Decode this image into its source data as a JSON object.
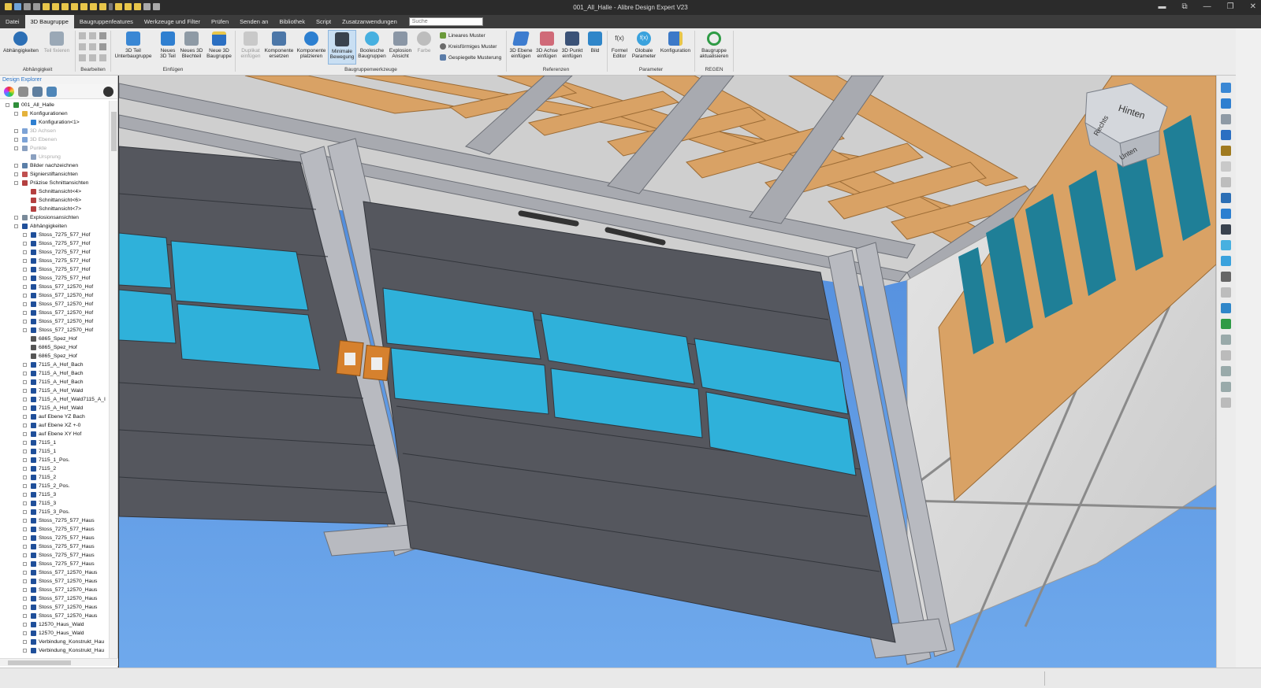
{
  "window": {
    "title": "001_All_Halle - Alibre Design Expert V23",
    "controls": [
      "▬",
      "⧉",
      "—",
      "❐",
      "✕"
    ]
  },
  "menu": {
    "items": [
      "Datei",
      "3D Baugruppe",
      "Baugruppenfeatures",
      "Werkzeuge und Filter",
      "Prüfen",
      "Senden an",
      "Bibliothek",
      "Script",
      "Zusatzanwendungen"
    ],
    "active_index": 1,
    "search_placeholder": "Suche"
  },
  "ribbon": {
    "groups": {
      "abhaengigkeit": "Abhängigkeit",
      "bearbeiten": "Bearbeiten",
      "einfuegen": "Einfügen",
      "baugruppenwerkzeuge": "Baugruppenwerkzeuge",
      "referenzen": "Referenzen",
      "parameter": "Parameter",
      "regen": "REGEN"
    },
    "buttons": {
      "abhaengigkeiten": [
        "Abhängigkeiten",
        ""
      ],
      "teil_fixieren": [
        "Teil fixieren",
        ""
      ],
      "teil_unterbaugruppe": [
        "3D Teil",
        "Unterbaugruppe"
      ],
      "neues_teil": [
        "Neues",
        "3D Teil"
      ],
      "neues_blechteil": [
        "Neues 3D",
        "Blechteil"
      ],
      "neue_baugruppe": [
        "Neue 3D",
        "Baugruppe"
      ],
      "duplikat": [
        "Duplikat",
        "einfügen"
      ],
      "komponente_ersetzen": [
        "Komponente",
        "ersetzen"
      ],
      "komponente_platzieren": [
        "Komponente",
        "platzieren"
      ],
      "minimale_bewegung": [
        "Minimale",
        "Bewegung"
      ],
      "boolesche": [
        "Boolesche",
        "Baugruppen"
      ],
      "explosion": [
        "Explosion",
        "Ansicht"
      ],
      "farbe": [
        "Farbe",
        ""
      ],
      "ebene": [
        "3D Ebene",
        "einfügen"
      ],
      "achse": [
        "3D Achse",
        "einfügen"
      ],
      "punkt": [
        "3D Punkt",
        "einfügen"
      ],
      "bild": [
        "Bild",
        ""
      ],
      "formel": [
        "Formel",
        "Editor"
      ],
      "globale": [
        "Globale",
        "Parameter"
      ],
      "konfiguration": [
        "Konfiguration",
        ""
      ],
      "aktualisieren": [
        "Baugruppe",
        "aktualisieren"
      ]
    },
    "patterns": [
      "Lineares Muster",
      "Kreisförmiges Muster",
      "Gespiegelte Musterung"
    ],
    "fx_glyph": "f(x)"
  },
  "explorer": {
    "title": "Design Explorer",
    "tree": [
      {
        "label": "001_All_Halle",
        "level": 0,
        "icon": "assembly"
      },
      {
        "label": "Konfigurationen",
        "level": 1,
        "icon": "folder"
      },
      {
        "label": "Konfiguration<1>",
        "level": 2,
        "icon": "config"
      },
      {
        "label": "3D Achsen",
        "level": 1,
        "icon": "axis",
        "gray": true
      },
      {
        "label": "3D Ebenen",
        "level": 1,
        "icon": "plane",
        "gray": true
      },
      {
        "label": "Punkte",
        "level": 1,
        "icon": "point",
        "gray": true
      },
      {
        "label": "Ursprung",
        "level": 2,
        "icon": "point",
        "gray": true
      },
      {
        "label": "Bilder nachzeichnen",
        "level": 1,
        "icon": "image"
      },
      {
        "label": "Signierstiftansichten",
        "level": 1,
        "icon": "pen"
      },
      {
        "label": "Präzise Schnittansichten",
        "level": 1,
        "icon": "section"
      },
      {
        "label": "Schnittansicht<4>",
        "level": 2,
        "icon": "section"
      },
      {
        "label": "Schnittansicht<6>",
        "level": 2,
        "icon": "section"
      },
      {
        "label": "Schnittansicht<7>",
        "level": 2,
        "icon": "section"
      },
      {
        "label": "Explosionsansichten",
        "level": 1,
        "icon": "explode"
      },
      {
        "label": "Abhängigkeiten",
        "level": 1,
        "icon": "constraint"
      },
      {
        "label": "Stoss_7275_577_Hof",
        "level": 2,
        "icon": "constraint"
      },
      {
        "label": "Stoss_7275_577_Hof",
        "level": 2,
        "icon": "constraint"
      },
      {
        "label": "Stoss_7275_577_Hof",
        "level": 2,
        "icon": "constraint"
      },
      {
        "label": "Stoss_7275_577_Hof",
        "level": 2,
        "icon": "constraint"
      },
      {
        "label": "Stoss_7275_577_Hof",
        "level": 2,
        "icon": "constraint"
      },
      {
        "label": "Stoss_7275_577_Hof",
        "level": 2,
        "icon": "constraint"
      },
      {
        "label": "Stoss_577_12570_Hof",
        "level": 2,
        "icon": "constraint"
      },
      {
        "label": "Stoss_577_12570_Hof",
        "level": 2,
        "icon": "constraint"
      },
      {
        "label": "Stoss_577_12570_Hof",
        "level": 2,
        "icon": "constraint"
      },
      {
        "label": "Stoss_577_12570_Hof",
        "level": 2,
        "icon": "constraint"
      },
      {
        "label": "Stoss_577_12570_Hof",
        "level": 2,
        "icon": "constraint"
      },
      {
        "label": "Stoss_577_12570_Hof",
        "level": 2,
        "icon": "constraint"
      },
      {
        "label": "6865_Spez_Hof",
        "level": 2,
        "icon": "gear"
      },
      {
        "label": "6865_Spez_Hof",
        "level": 2,
        "icon": "gear"
      },
      {
        "label": "6865_Spez_Hof",
        "level": 2,
        "icon": "gear"
      },
      {
        "label": "7115_A_Hof_Bach",
        "level": 2,
        "icon": "constraint"
      },
      {
        "label": "7115_A_Hof_Bach",
        "level": 2,
        "icon": "constraint"
      },
      {
        "label": "7115_A_Hof_Bach",
        "level": 2,
        "icon": "constraint"
      },
      {
        "label": "7115_A_Hof_Wald",
        "level": 2,
        "icon": "constraint"
      },
      {
        "label": "7115_A_Hof_Wald7115_A_I",
        "level": 2,
        "icon": "constraint"
      },
      {
        "label": "7115_A_Hof_Wald",
        "level": 2,
        "icon": "constraint"
      },
      {
        "label": "auf Ebene YZ Bach",
        "level": 2,
        "icon": "constraint"
      },
      {
        "label": "auf Ebene XZ +-0",
        "level": 2,
        "icon": "constraint"
      },
      {
        "label": "auf Ebene XY Hof",
        "level": 2,
        "icon": "constraint"
      },
      {
        "label": "7115_1",
        "level": 2,
        "icon": "constraint"
      },
      {
        "label": "7115_1",
        "level": 2,
        "icon": "constraint"
      },
      {
        "label": "7115_1_Pos.",
        "level": 2,
        "icon": "constraint"
      },
      {
        "label": "7115_2",
        "level": 2,
        "icon": "constraint"
      },
      {
        "label": "7115_2",
        "level": 2,
        "icon": "constraint"
      },
      {
        "label": "7115_2_Pos.",
        "level": 2,
        "icon": "constraint"
      },
      {
        "label": "7115_3",
        "level": 2,
        "icon": "constraint"
      },
      {
        "label": "7115_3",
        "level": 2,
        "icon": "constraint"
      },
      {
        "label": "7115_3_Pos.",
        "level": 2,
        "icon": "constraint"
      },
      {
        "label": "Stoss_7275_577_Haus",
        "level": 2,
        "icon": "constraint"
      },
      {
        "label": "Stoss_7275_577_Haus",
        "level": 2,
        "icon": "constraint"
      },
      {
        "label": "Stoss_7275_577_Haus",
        "level": 2,
        "icon": "constraint"
      },
      {
        "label": "Stoss_7275_577_Haus",
        "level": 2,
        "icon": "constraint"
      },
      {
        "label": "Stoss_7275_577_Haus",
        "level": 2,
        "icon": "constraint"
      },
      {
        "label": "Stoss_7275_577_Haus",
        "level": 2,
        "icon": "constraint"
      },
      {
        "label": "Stoss_577_12570_Haus",
        "level": 2,
        "icon": "constraint"
      },
      {
        "label": "Stoss_577_12570_Haus",
        "level": 2,
        "icon": "constraint"
      },
      {
        "label": "Stoss_577_12570_Haus",
        "level": 2,
        "icon": "constraint"
      },
      {
        "label": "Stoss_577_12570_Haus",
        "level": 2,
        "icon": "constraint"
      },
      {
        "label": "Stoss_577_12570_Haus",
        "level": 2,
        "icon": "constraint"
      },
      {
        "label": "Stoss_577_12570_Haus",
        "level": 2,
        "icon": "constraint"
      },
      {
        "label": "12570_Haus_Wald",
        "level": 2,
        "icon": "constraint"
      },
      {
        "label": "12570_Haus_Wald",
        "level": 2,
        "icon": "constraint"
      },
      {
        "label": "Verbindung_Konstrukt_Hau",
        "level": 2,
        "icon": "constraint"
      },
      {
        "label": "Verbindung_Konstrukt_Hau",
        "level": 2,
        "icon": "constraint"
      }
    ]
  },
  "viewcube": {
    "top": "Hinten",
    "left": "Rechts",
    "bottom": "Unten"
  },
  "colors": {
    "accent": "#2a74c8",
    "ribbon_bg": "#ececec",
    "titlebar": "#2b2b2b",
    "menubar": "#3c3c3c",
    "glass": "#29a9d6",
    "door": "#55575e",
    "wood": "#d9a265"
  }
}
